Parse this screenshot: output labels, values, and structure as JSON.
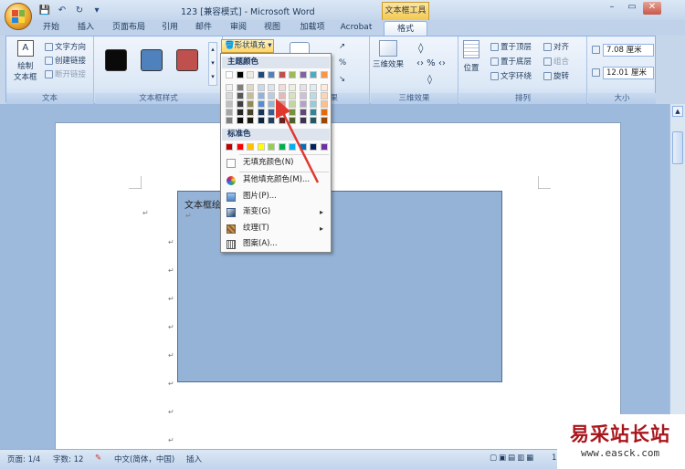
{
  "window": {
    "title": "123 [兼容模式] - Microsoft Word",
    "context_tab_title": "文本框工具"
  },
  "qat": {
    "save": "💾",
    "undo": "↶",
    "redo": "↻",
    "more": "▾"
  },
  "tabs": [
    {
      "label": "开始"
    },
    {
      "label": "插入"
    },
    {
      "label": "页面布局"
    },
    {
      "label": "引用"
    },
    {
      "label": "邮件"
    },
    {
      "label": "审阅"
    },
    {
      "label": "视图"
    },
    {
      "label": "加载项"
    },
    {
      "label": "Acrobat"
    },
    {
      "label": "格式"
    }
  ],
  "ribbon": {
    "text_group": {
      "label": "文本",
      "draw_textbox": "绘制",
      "draw_textbox2": "文本框",
      "text_direction": "文字方向",
      "create_link": "创建链接",
      "break_link": "断开链接"
    },
    "textbox_styles": {
      "label": "文本框样式",
      "swatch_colors": [
        "#0a0a0a",
        "#4f81bd",
        "#c0504d"
      ]
    },
    "shape_fill": "形状填充",
    "shadow_group": {
      "label": "阴影效果"
    },
    "three_d": {
      "label": "三维效果",
      "button": "三维效果"
    },
    "arrange": {
      "label": "排列",
      "position": "位置",
      "bring_front": "置于顶层",
      "send_back": "置于底层",
      "text_wrap": "文字环绕",
      "align": "对齐",
      "group": "组合",
      "rotate": "旋转"
    },
    "size": {
      "label": "大小",
      "height": "7.08 厘米",
      "width": "12.01 厘米"
    }
  },
  "document": {
    "textbox_text": "文本框绘"
  },
  "dropdown": {
    "theme_header": "主题颜色",
    "standard_header": "标准色",
    "theme_top": [
      "#ffffff",
      "#000000",
      "#eeece1",
      "#1f497d",
      "#4f81bd",
      "#c0504d",
      "#9bbb59",
      "#8064a2",
      "#4bacc6",
      "#f79646"
    ],
    "theme_shades": [
      [
        "#f2f2f2",
        "#7f7f7f",
        "#ddd9c3",
        "#c6d9f0",
        "#dbe5f1",
        "#f2dcdb",
        "#ebf1dd",
        "#e5e0ec",
        "#dbeef3",
        "#fdeada"
      ],
      [
        "#d8d8d8",
        "#595959",
        "#c4bd97",
        "#8db3e2",
        "#b8cce4",
        "#e5b9b7",
        "#d7e3bc",
        "#ccc1d9",
        "#b7dde8",
        "#fbd5b5"
      ],
      [
        "#bfbfbf",
        "#3f3f3f",
        "#938953",
        "#548dd4",
        "#95b3d7",
        "#d99694",
        "#c3d69b",
        "#b2a2c7",
        "#92cddc",
        "#fac08f"
      ],
      [
        "#a5a5a5",
        "#262626",
        "#494429",
        "#17365d",
        "#366092",
        "#953734",
        "#76923c",
        "#5f497a",
        "#31859b",
        "#e36c09"
      ],
      [
        "#7f7f7f",
        "#0c0c0c",
        "#1d1b10",
        "#0f243e",
        "#244061",
        "#632423",
        "#4f6128",
        "#3f3151",
        "#205867",
        "#974806"
      ]
    ],
    "standard_colors": [
      "#c00000",
      "#ff0000",
      "#ffc000",
      "#ffff00",
      "#92d050",
      "#00b050",
      "#00b0f0",
      "#0070c0",
      "#002060",
      "#7030a0"
    ],
    "items": [
      {
        "label": "无填充颜色(N)"
      },
      {
        "label": "其他填充颜色(M)..."
      },
      {
        "label": "图片(P)..."
      },
      {
        "label": "渐变(G)"
      },
      {
        "label": "纹理(T)"
      },
      {
        "label": "图案(A)..."
      }
    ]
  },
  "status": {
    "page": "页面: 1/4",
    "words": "字数: 12",
    "language": "中文(简体，中国)",
    "mode": "插入",
    "zoom": "110%"
  },
  "watermark": {
    "cn": "易采站长站",
    "url": "www.easck.com"
  },
  "colors": {
    "annotation_arrow": "#e0382f",
    "textbox_fill": "#95b3d7"
  }
}
